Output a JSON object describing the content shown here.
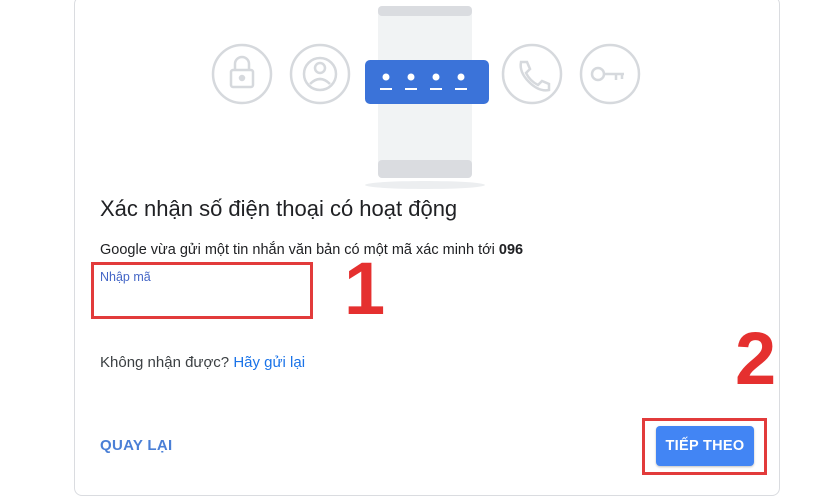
{
  "illustration": {
    "icons": [
      "lock-icon",
      "person-icon",
      "phone-call-icon",
      "key-icon"
    ],
    "code_dots": 4,
    "accent_color": "#3b73d9"
  },
  "verification": {
    "heading": "Xác nhận số điện thoại có hoạt động",
    "description_prefix": "Google vừa gửi một tin nhắn văn bản có một mã xác minh tới ",
    "phone_prefix": "096",
    "code_label": "Nhập mã",
    "code_value": "",
    "resend_prompt": "Không nhận được? ",
    "resend_link": "Hãy gửi lại"
  },
  "actions": {
    "back_label": "QUAY LẠI",
    "next_label": "TIẾP THEO",
    "next_color": "#4285f4"
  },
  "annotations": {
    "step1_label": "1",
    "step2_label": "2",
    "annotation_color": "#e5302f"
  }
}
